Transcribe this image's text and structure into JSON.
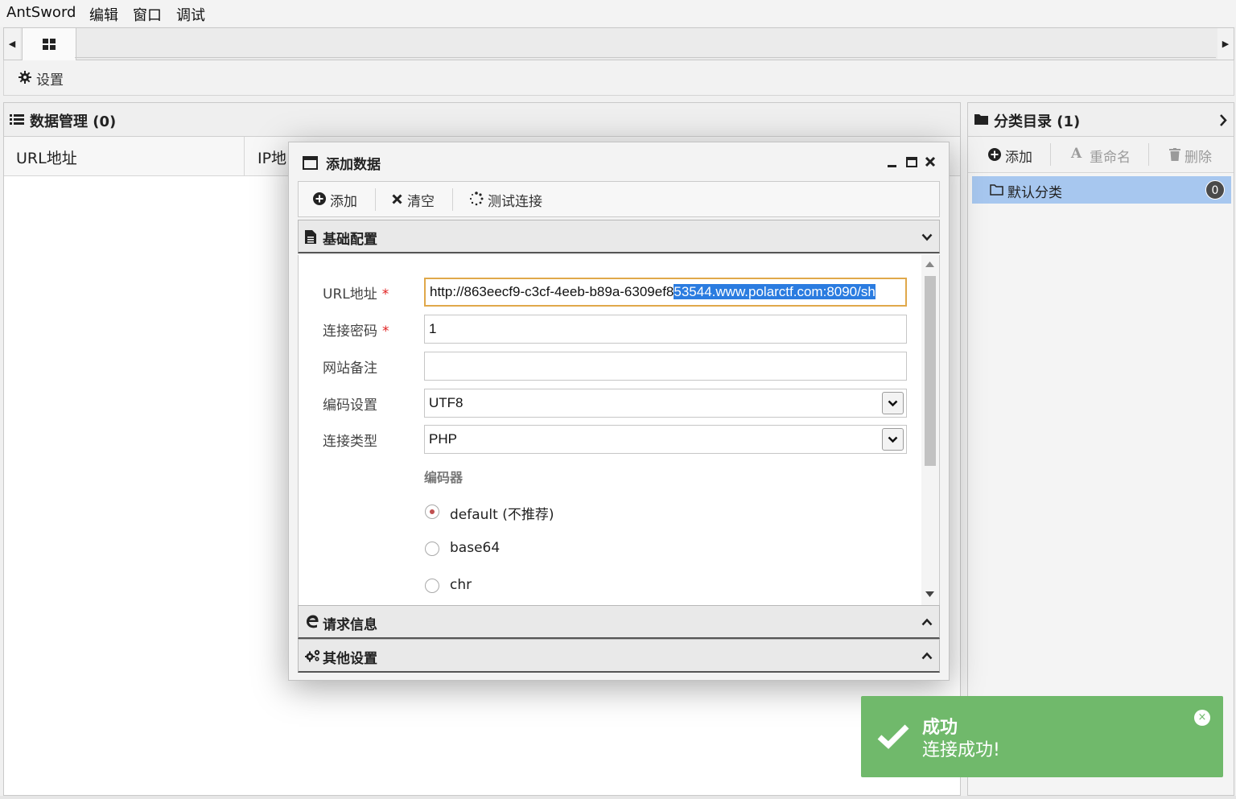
{
  "menubar": {
    "items": [
      "AntSword",
      "编辑",
      "窗口",
      "调试"
    ]
  },
  "tabbar": {
    "left_arrow": "◀",
    "right_arrow": "▶",
    "home_tab_icon": "grid-icon"
  },
  "settings": {
    "label": "设置",
    "icon": "gear-icon"
  },
  "data_panel": {
    "title": "数据管理 (0)",
    "columns": [
      "URL地址",
      "IP地"
    ]
  },
  "category_panel": {
    "title": "分类目录 (1)",
    "toolbar": {
      "add": "添加",
      "rename": "重命名",
      "delete": "删除"
    },
    "items": [
      {
        "label": "默认分类",
        "count": "0"
      }
    ]
  },
  "dialog": {
    "title": "添加数据",
    "toolbar": {
      "add": "添加",
      "clear": "清空",
      "test": "测试连接"
    },
    "sections": {
      "basic": "基础配置",
      "request": "请求信息",
      "other": "其他设置"
    },
    "form": {
      "url_label": "URL地址",
      "url_value_plain": "http://863eecf9-c3cf-4eeb-b89a-6309ef8",
      "url_value_selected": "53544.www.polarctf.com:8090/sh",
      "password_label": "连接密码",
      "password_value": "1",
      "note_label": "网站备注",
      "note_value": "",
      "encoding_label": "编码设置",
      "encoding_value": "UTF8",
      "type_label": "连接类型",
      "type_value": "PHP",
      "encoder_label": "编码器",
      "required_mark": "*",
      "encoders": [
        {
          "label": "default (不推荐)",
          "selected": true
        },
        {
          "label": "base64",
          "selected": false
        },
        {
          "label": "chr",
          "selected": false
        }
      ]
    }
  },
  "toast": {
    "title": "成功",
    "message": "连接成功!",
    "color": "#70b96b",
    "close": "×"
  }
}
